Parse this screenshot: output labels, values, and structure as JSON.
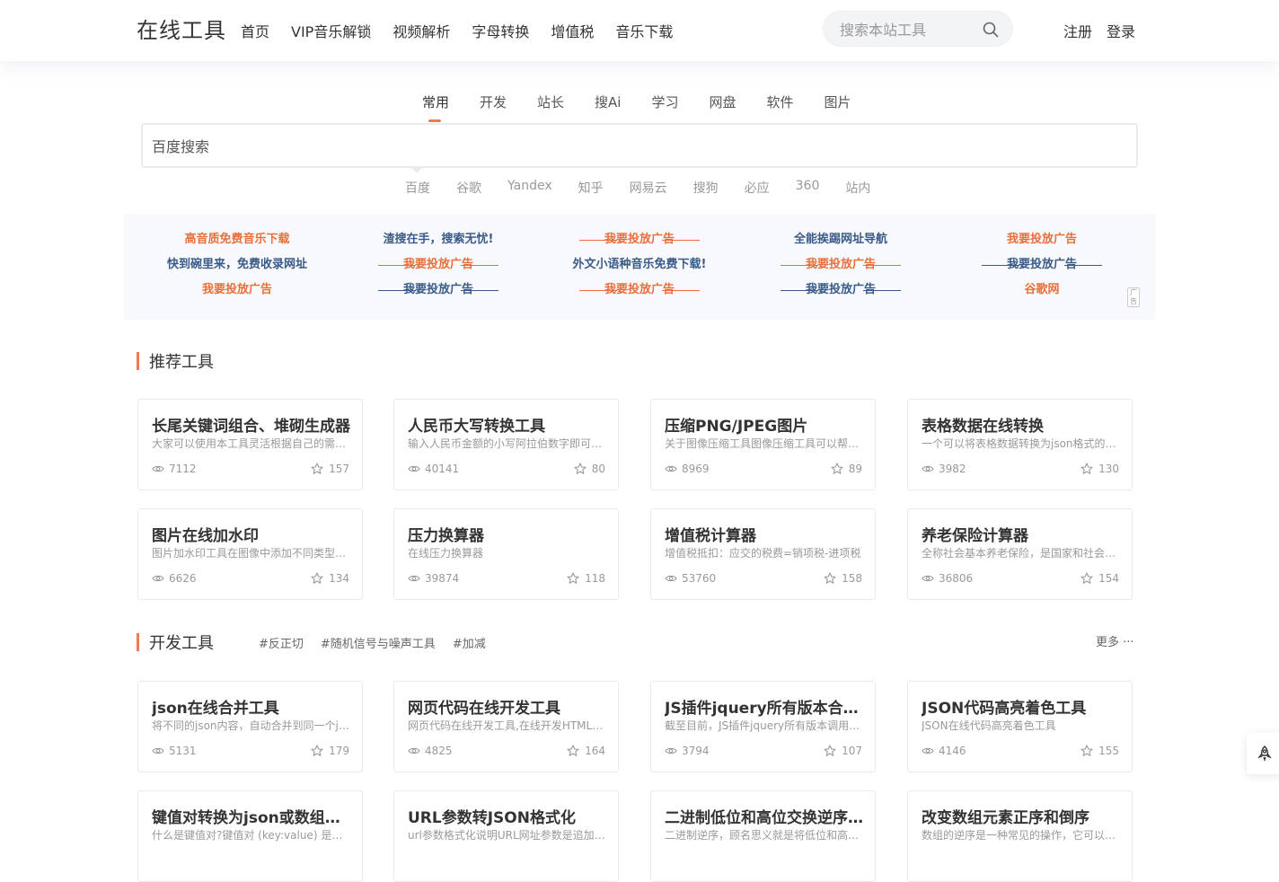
{
  "header": {
    "logo": "在线工具",
    "nav": [
      "首页",
      "VIP音乐解锁",
      "视频解析",
      "字母转换",
      "增值税",
      "音乐下载"
    ],
    "search_placeholder": "搜索本站工具",
    "register": "注册",
    "login": "登录"
  },
  "search": {
    "tabs": [
      "常用",
      "开发",
      "站长",
      "搜Ai",
      "学习",
      "网盘",
      "软件",
      "图片"
    ],
    "active_tab": "常用",
    "placeholder": "百度搜索",
    "engines": [
      "百度",
      "谷歌",
      "Yandex",
      "知乎",
      "网易云",
      "搜狗",
      "必应",
      "360",
      "站内"
    ]
  },
  "ads": {
    "columns": [
      [
        {
          "text": "高音质免费音乐下载",
          "color": "orange",
          "struck": false
        },
        {
          "text": "快到碗里来，免费收录网址",
          "color": "blue",
          "struck": false
        },
        {
          "text": "我要投放广告",
          "color": "orange",
          "struck": false
        }
      ],
      [
        {
          "text": "渣搜在手，搜索无忧!",
          "color": "blue",
          "struck": false
        },
        {
          "text": "我要投放广告",
          "color": "orange",
          "struck": true
        },
        {
          "text": "我要投放广告",
          "color": "blue",
          "struck": true
        }
      ],
      [
        {
          "text": "我要投放广告",
          "color": "orange",
          "struck": true
        },
        {
          "text": "外文小语种音乐免费下载!",
          "color": "blue",
          "struck": false
        },
        {
          "text": "我要投放广告",
          "color": "orange",
          "struck": true
        }
      ],
      [
        {
          "text": "全能挨踢网址导航",
          "color": "blue",
          "struck": false
        },
        {
          "text": "我要投放广告",
          "color": "orange",
          "struck": true
        },
        {
          "text": "我要投放广告",
          "color": "blue",
          "struck": true
        }
      ],
      [
        {
          "text": "我要投放广告",
          "color": "orange",
          "struck": false
        },
        {
          "text": "我要投放广告",
          "color": "blue",
          "struck": true
        },
        {
          "text": "谷歌网",
          "color": "orange",
          "struck": false
        }
      ]
    ],
    "close_label": "广告"
  },
  "recommended": {
    "title": "推荐工具",
    "cards": [
      {
        "title": "长尾关键词组合、堆砌生成器",
        "desc": "大家可以使用本工具灵活根据自己的需求，生成长尾关键词",
        "views": "7112",
        "stars": "157"
      },
      {
        "title": "人民币大写转换工具",
        "desc": "输入人民币金额的小写阿拉伯数字即可转换为大写",
        "views": "40141",
        "stars": "80"
      },
      {
        "title": "压缩PNG/JPEG图片",
        "desc": "关于图像压缩工具图像压缩工具可以帮助您压缩图片",
        "views": "8969",
        "stars": "89"
      },
      {
        "title": "表格数据在线转换",
        "desc": "一个可以将表格数据转换为json格式的在线工具",
        "views": "3982",
        "stars": "130"
      },
      {
        "title": "图片在线加水印",
        "desc": "图片加水印工具在图像中添加不同类型的水印",
        "views": "6626",
        "stars": "134"
      },
      {
        "title": "压力换算器",
        "desc": "在线压力换算器",
        "views": "39874",
        "stars": "118"
      },
      {
        "title": "增值税计算器",
        "desc": "增值税抵扣：应交的税费=销项税-进项税",
        "views": "53760",
        "stars": "158"
      },
      {
        "title": "养老保险计算器",
        "desc": "全称社会基本养老保险，是国家和社会根据一定的法律",
        "views": "36806",
        "stars": "154"
      }
    ]
  },
  "dev": {
    "title": "开发工具",
    "tags": [
      "#反正切",
      "#随机信号与噪声工具",
      "#加减"
    ],
    "more": "更多 ···",
    "cards": [
      {
        "title": "json在线合并工具",
        "desc": "将不同的json内容，自动合并到同一个json对象中",
        "views": "5131",
        "stars": "179"
      },
      {
        "title": "网页代码在线开发工具",
        "desc": "网页代码在线开发工具,在线开发HTML代码并实时预览",
        "views": "4825",
        "stars": "164"
      },
      {
        "title": "JS插件jquery所有版本合集。",
        "desc": "截至目前，JS插件jquery所有版本调用地址",
        "views": "3794",
        "stars": "107"
      },
      {
        "title": "JSON代码高亮着色工具",
        "desc": "JSON在线代码高亮着色工具",
        "views": "4146",
        "stars": "155"
      },
      {
        "title": "键值对转换为json或数组格式",
        "desc": "什么是键值对?键值对 (key:value) 是一种数据结构",
        "views": "",
        "stars": ""
      },
      {
        "title": "URL参数转JSON格式化",
        "desc": "url参数格式化说明URL网址参数是追加在链接后的",
        "views": "",
        "stars": ""
      },
      {
        "title": "二进制低位和高位交换逆序(反转)",
        "desc": "二进制逆序，顾名思义就是将低位和高位交换",
        "views": "",
        "stars": ""
      },
      {
        "title": "改变数组元素正序和倒序",
        "desc": "数组的逆序是一种常见的操作，它可以将数组反转",
        "views": "",
        "stars": ""
      }
    ]
  },
  "colors": {
    "accent": "#ef7b4f",
    "ad_orange": "#e8703d",
    "ad_blue": "#3a5a8a"
  },
  "icons": {
    "search": "magnifier-icon",
    "views": "eye-icon",
    "stars": "star-icon",
    "float": "rocket-icon"
  }
}
